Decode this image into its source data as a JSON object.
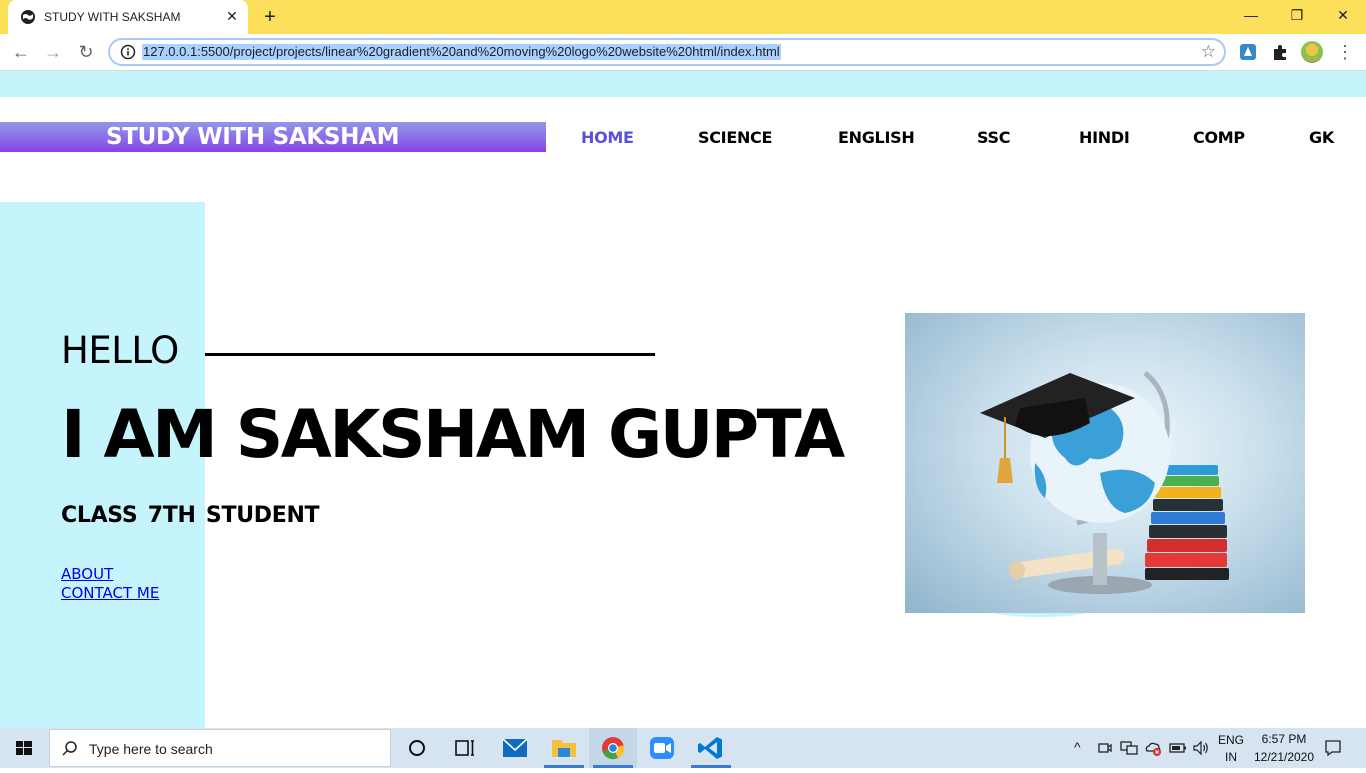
{
  "browser": {
    "tab": {
      "title": "STUDY WITH SAKSHAM",
      "close": "✕"
    },
    "new_tab": "+",
    "window_controls": {
      "minimize": "—",
      "restore": "❐",
      "close": "✕"
    },
    "nav": {
      "back": "←",
      "forward": "→",
      "reload": "↻"
    },
    "url": "127.0.0.1:5500/project/projects/linear%20gradient%20and%20moving%20logo%20website%20html/index.html",
    "bookmark_icon": "☆",
    "menu": "⋮"
  },
  "site": {
    "logo": "STUDY WITH SAKSHAM",
    "nav": [
      "HOME",
      "SCIENCE",
      "ENGLISH",
      "SSC",
      "HINDI",
      "COMP",
      "GK"
    ],
    "hero": {
      "greeting": "HELLO",
      "name": "I AM SAKSHAM GUPTA",
      "subtitle": "CLASS 7TH STUDENT",
      "links": [
        "ABOUT",
        "CONTACT ME"
      ]
    },
    "colors": {
      "accent": "#5b4fe0",
      "panel": "#c5f4fc",
      "logo_gradient_start": "#8f98e6",
      "logo_gradient_end": "#8e3fe6"
    }
  },
  "taskbar": {
    "search_placeholder": "Type here to search",
    "icons": [
      "windows-icon",
      "cortana-icon",
      "task-view-icon",
      "mail-icon",
      "file-explorer-icon",
      "chrome-icon",
      "zoom-icon",
      "vscode-icon"
    ],
    "tray": {
      "chevron": "^",
      "language_top": "ENG",
      "language_bottom": "IN",
      "time": "6:57 PM",
      "date": "12/21/2020"
    }
  }
}
